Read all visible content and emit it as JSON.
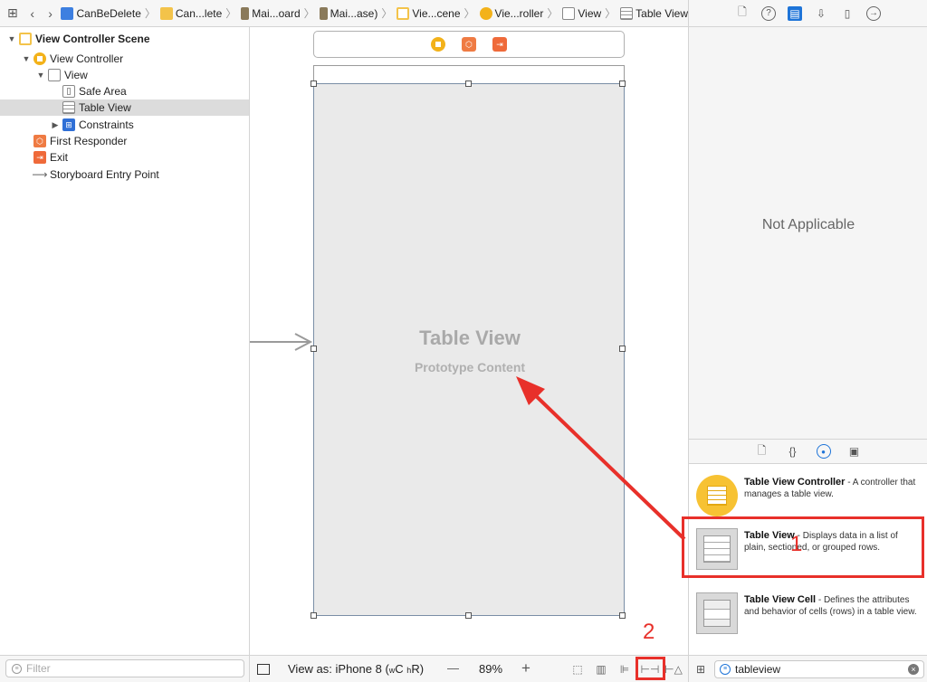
{
  "jumpbar": {
    "crumbs": [
      {
        "label": "CanBeDelete",
        "icon": "project-icon",
        "color": "#3d7fe0"
      },
      {
        "label": "Can...lete",
        "icon": "folder-icon",
        "color": "#f3c34a"
      },
      {
        "label": "Mai...oard",
        "icon": "storyboard-icon",
        "color": "#8a7a5a"
      },
      {
        "label": "Mai...ase)",
        "icon": "storyboard-icon",
        "color": "#8a7a5a"
      },
      {
        "label": "Vie...cene",
        "icon": "scene-icon",
        "color": "#f3c34a"
      },
      {
        "label": "Vie...roller",
        "icon": "view-controller-icon",
        "color": "#f3b21a"
      },
      {
        "label": "View",
        "icon": "view-icon",
        "color": "#ffffff"
      },
      {
        "label": "Table View",
        "icon": "table-view-icon",
        "color": "#ffffff"
      }
    ]
  },
  "outline": {
    "items": [
      {
        "label": "View Controller Scene",
        "bold": true
      },
      {
        "label": "View Controller"
      },
      {
        "label": "View"
      },
      {
        "label": "Safe Area"
      },
      {
        "label": "Table View",
        "selected": true
      },
      {
        "label": "Constraints"
      },
      {
        "label": "First Responder"
      },
      {
        "label": "Exit"
      },
      {
        "label": "Storyboard Entry Point"
      }
    ],
    "filter_placeholder": "Filter"
  },
  "canvas": {
    "table_title": "Table View",
    "table_subtitle": "Prototype Content"
  },
  "bottombar": {
    "view_as": "View as: iPhone 8 (",
    "size_class_w": "w",
    "size_class_c": "C",
    "size_class_h": "h",
    "size_class_r": "R",
    "view_as_close": ")",
    "zoom_minus": "—",
    "zoom": "89%",
    "zoom_plus": "+"
  },
  "inspector": {
    "message": "Not Applicable"
  },
  "library": {
    "items": [
      {
        "name": "Table View Controller",
        "desc": " - A controller that manages a table view."
      },
      {
        "name": "Table View",
        "desc": " - Displays data in a list of plain, sectioned, or grouped rows."
      },
      {
        "name": "Table View Cell",
        "desc": " - Defines the attributes and behavior of cells (rows) in a table view."
      }
    ],
    "search_value": "tableview"
  },
  "annotations": {
    "label1": "1",
    "label2": "2",
    "color": "#e8302a"
  },
  "colors": {
    "accent": "#1e74d8",
    "selection": "#dcdcdc",
    "vc_yellow": "#f3b21a",
    "responder_orange": "#ef7b43"
  }
}
